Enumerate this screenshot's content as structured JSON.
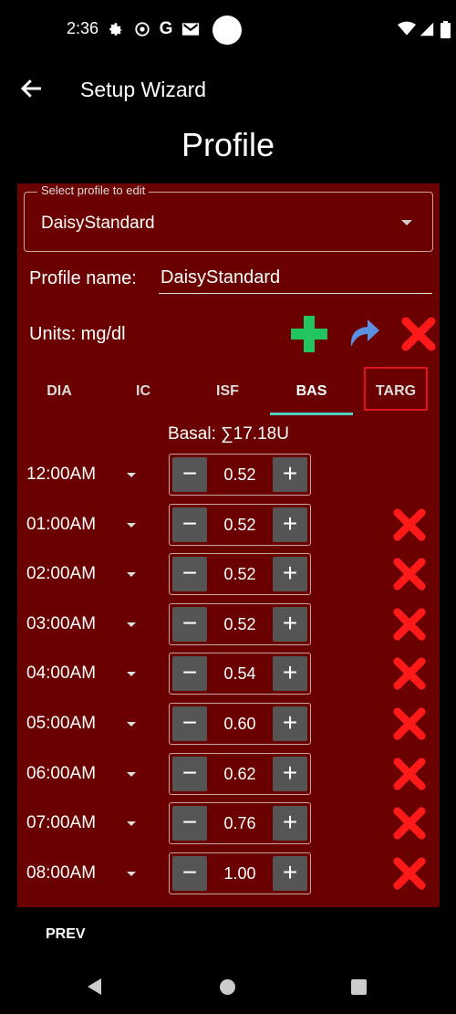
{
  "status_bar": {
    "time": "2:36",
    "icons": [
      "gear-icon",
      "at-icon",
      "google-icon",
      "gmail-icon",
      "wifi-icon",
      "signal-icon",
      "battery-icon"
    ]
  },
  "app_bar": {
    "title": "Setup Wizard"
  },
  "page": {
    "title": "Profile"
  },
  "profile_select": {
    "legend": "Select profile to edit",
    "value": "DaisyStandard"
  },
  "profile_name": {
    "label": "Profile name:",
    "value": "DaisyStandard"
  },
  "units": {
    "label": "Units: mg/dl"
  },
  "tabs": [
    {
      "label": "DIA"
    },
    {
      "label": "IC"
    },
    {
      "label": "ISF"
    },
    {
      "label": "BAS",
      "active": true
    },
    {
      "label": "TARG"
    }
  ],
  "basal": {
    "summary": "Basal:  ∑17.18U"
  },
  "basal_rows": [
    {
      "time": "12:00AM",
      "value": "0.52",
      "deletable": false
    },
    {
      "time": "01:00AM",
      "value": "0.52",
      "deletable": true
    },
    {
      "time": "02:00AM",
      "value": "0.52",
      "deletable": true
    },
    {
      "time": "03:00AM",
      "value": "0.52",
      "deletable": true
    },
    {
      "time": "04:00AM",
      "value": "0.54",
      "deletable": true
    },
    {
      "time": "05:00AM",
      "value": "0.60",
      "deletable": true
    },
    {
      "time": "06:00AM",
      "value": "0.62",
      "deletable": true
    },
    {
      "time": "07:00AM",
      "value": "0.76",
      "deletable": true
    },
    {
      "time": "08:00AM",
      "value": "1.00",
      "deletable": true
    }
  ],
  "footer": {
    "prev_label": "PREV"
  },
  "colors": {
    "panel": "#6b0000",
    "accent_tab": "#4fd1c5",
    "add": "#22c55e",
    "redo": "#5b8fe0",
    "delete": "#ff1a1a",
    "highlight_box": "#e0141d"
  }
}
